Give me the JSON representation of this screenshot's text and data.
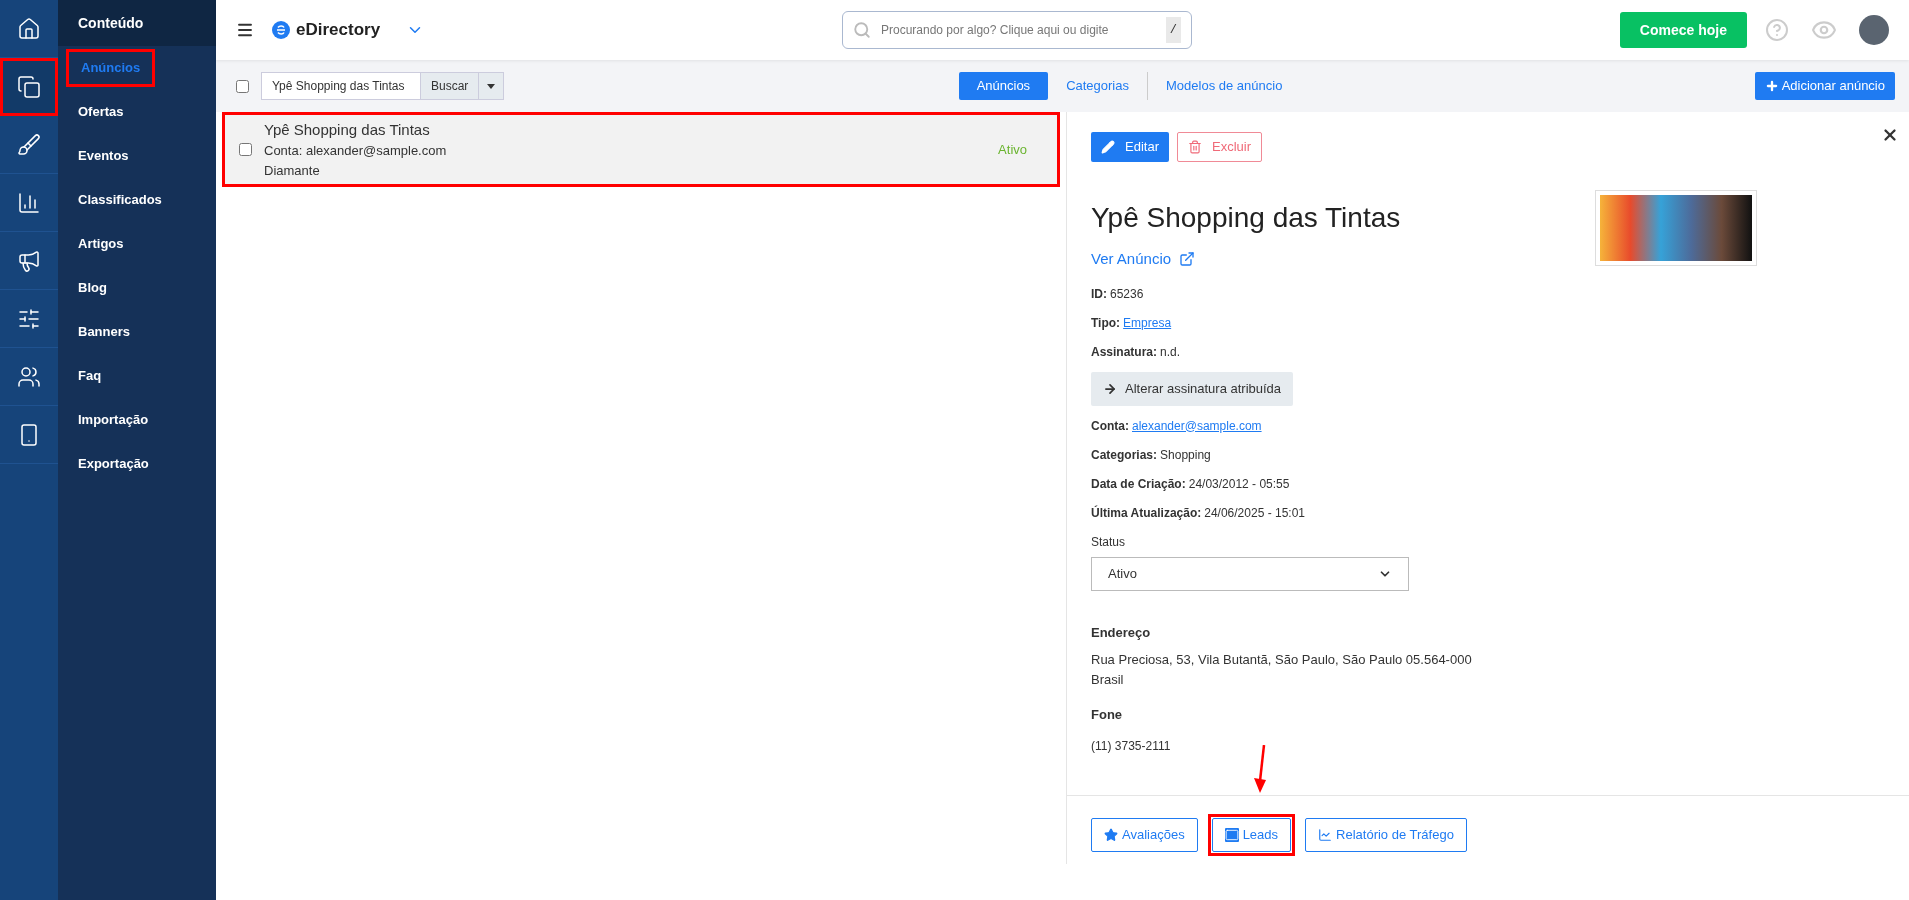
{
  "rail": [
    {
      "kind": "home",
      "selected": false,
      "highlighted": false
    },
    {
      "kind": "content",
      "selected": true,
      "highlighted": true
    },
    {
      "kind": "design",
      "selected": false,
      "highlighted": false
    },
    {
      "kind": "reports",
      "selected": false,
      "highlighted": false
    },
    {
      "kind": "promote",
      "selected": false,
      "highlighted": false
    },
    {
      "kind": "settings",
      "selected": false,
      "highlighted": false
    },
    {
      "kind": "users",
      "selected": false,
      "highlighted": false
    },
    {
      "kind": "mobile",
      "selected": false,
      "highlighted": false
    }
  ],
  "submenu": {
    "title": "Conteúdo",
    "items": [
      {
        "label": "Anúncios",
        "selected": true,
        "highlighted": true
      },
      {
        "label": "Ofertas",
        "selected": false,
        "highlighted": false
      },
      {
        "label": "Eventos",
        "selected": false,
        "highlighted": false
      },
      {
        "label": "Classificados",
        "selected": false,
        "highlighted": false
      },
      {
        "label": "Artigos",
        "selected": false,
        "highlighted": false
      },
      {
        "label": "Blog",
        "selected": false,
        "highlighted": false
      },
      {
        "label": "Banners",
        "selected": false,
        "highlighted": false
      },
      {
        "label": "Faq",
        "selected": false,
        "highlighted": false
      },
      {
        "label": "Importação",
        "selected": false,
        "highlighted": false
      },
      {
        "label": "Exportação",
        "selected": false,
        "highlighted": false
      }
    ]
  },
  "topbar": {
    "brand": "eDirectory",
    "search": {
      "placeholder": "Procurando por algo? Clique aqui ou digite",
      "shortcut": "/"
    },
    "cta": "Comece hoje"
  },
  "toolbar": {
    "select_all": {
      "checked": false
    },
    "search_value": "Ypê Shopping das Tintas",
    "search_button": "Buscar",
    "tabs": [
      {
        "label": "Anúncios",
        "selected": true
      },
      {
        "label": "Categorias",
        "selected": false
      },
      {
        "label": "Modelos de anúncio",
        "selected": false
      }
    ],
    "add_button": "Adicionar anúncio"
  },
  "listings": [
    {
      "title": "Ypê Shopping das Tintas",
      "account": "Conta: alexander@sample.com",
      "level": "Diamante",
      "status": "Ativo",
      "checked": false,
      "selected": true,
      "highlighted": true
    }
  ],
  "detail": {
    "edit_button": "Editar",
    "delete_button": "Excluir",
    "title": "Ypê Shopping das Tintas",
    "view_link": "Ver Anúncio",
    "fields": [
      {
        "kind": "text",
        "label": "ID:",
        "value": "65236"
      },
      {
        "kind": "link",
        "label": "Tipo:",
        "value": "Empresa"
      },
      {
        "kind": "text",
        "label": "Assinatura:",
        "value": "n.d."
      },
      {
        "kind": "button",
        "value": "Alterar assinatura atribuída"
      },
      {
        "kind": "link",
        "label": "Conta:",
        "value": "alexander@sample.com"
      },
      {
        "kind": "text",
        "label": "Categorias:",
        "value": "Shopping"
      },
      {
        "kind": "text",
        "label": "Data de Criação:",
        "value": "24/03/2012 - 05:55"
      },
      {
        "kind": "text",
        "label": "Última Atualização:",
        "value": "24/06/2025 - 15:01"
      }
    ],
    "status": {
      "label": "Status",
      "value": "Ativo"
    },
    "address": {
      "heading": "Endereço",
      "lines": [
        "Rua Preciosa, 53, Vila Butantã, São Paulo, São Paulo 05.564-000",
        "Brasil"
      ]
    },
    "phone": {
      "heading": "Fone",
      "value": "(11) 3735-2111"
    },
    "actions": [
      {
        "kind": "star",
        "label": "Avaliações",
        "highlighted": false
      },
      {
        "kind": "mail",
        "label": "Leads",
        "highlighted": true
      },
      {
        "kind": "chart",
        "label": "Relatório de Tráfego",
        "highlighted": false
      }
    ]
  }
}
